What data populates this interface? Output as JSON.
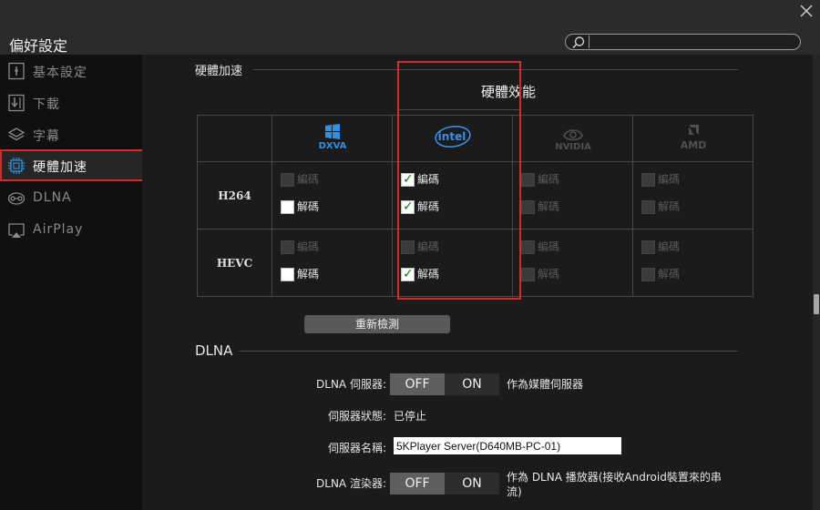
{
  "window": {
    "title": "偏好設定"
  },
  "search": {
    "placeholder": "",
    "value": ""
  },
  "sidebar": {
    "items": [
      {
        "label": "基本設定",
        "icon": "settings-panel-icon",
        "active": false
      },
      {
        "label": "下載",
        "icon": "download-icon",
        "active": false
      },
      {
        "label": "字幕",
        "icon": "layers-icon",
        "active": false
      },
      {
        "label": "硬體加速",
        "icon": "chip-icon",
        "active": true
      },
      {
        "label": "DLNA",
        "icon": "dlna-icon",
        "active": false
      },
      {
        "label": "AirPlay",
        "icon": "airplay-icon",
        "active": false
      }
    ]
  },
  "hardware": {
    "section_title": "硬體加速",
    "performance_label": "硬體效能",
    "columns": [
      {
        "name": "DXVA",
        "logo": "windows-dxva-logo"
      },
      {
        "name": "intel",
        "logo": "intel-logo"
      },
      {
        "name": "NVIDIA",
        "logo": "nvidia-logo"
      },
      {
        "name": "AMD",
        "logo": "amd-logo"
      }
    ],
    "rows": [
      {
        "codec": "H264",
        "cells": [
          {
            "encode": {
              "label": "編碼",
              "checked": false,
              "enabled": false
            },
            "decode": {
              "label": "解碼",
              "checked": false,
              "enabled": true
            }
          },
          {
            "encode": {
              "label": "編碼",
              "checked": true,
              "enabled": true
            },
            "decode": {
              "label": "解碼",
              "checked": true,
              "enabled": true
            }
          },
          {
            "encode": {
              "label": "編碼",
              "checked": false,
              "enabled": false
            },
            "decode": {
              "label": "解碼",
              "checked": false,
              "enabled": false
            }
          },
          {
            "encode": {
              "label": "編碼",
              "checked": false,
              "enabled": false
            },
            "decode": {
              "label": "解碼",
              "checked": false,
              "enabled": false
            }
          }
        ]
      },
      {
        "codec": "HEVC",
        "cells": [
          {
            "encode": {
              "label": "編碼",
              "checked": false,
              "enabled": false
            },
            "decode": {
              "label": "解碼",
              "checked": false,
              "enabled": true
            }
          },
          {
            "encode": {
              "label": "編碼",
              "checked": false,
              "enabled": false
            },
            "decode": {
              "label": "解碼",
              "checked": true,
              "enabled": true
            }
          },
          {
            "encode": {
              "label": "編碼",
              "checked": false,
              "enabled": false
            },
            "decode": {
              "label": "解碼",
              "checked": false,
              "enabled": false
            }
          },
          {
            "encode": {
              "label": "編碼",
              "checked": false,
              "enabled": false
            },
            "decode": {
              "label": "解碼",
              "checked": false,
              "enabled": false
            }
          }
        ]
      }
    ],
    "redetect_label": "重新檢測"
  },
  "dlna": {
    "section_title": "DLNA",
    "server_label": "DLNA 伺服器:",
    "server_off": "OFF",
    "server_on": "ON",
    "server_note": "作為媒體伺服器",
    "status_label": "伺服器狀態:",
    "status_value": "已停止",
    "name_label": "伺服器名稱:",
    "name_value": "5KPlayer Server(D640MB-PC-01)",
    "renderer_label": "DLNA 渲染器:",
    "renderer_off": "OFF",
    "renderer_on": "ON",
    "renderer_note_line1": "作為 DLNA 播放器(接收Android裝置來的串",
    "renderer_note_line2": "流)"
  },
  "colors": {
    "accent_red": "#d42a2a",
    "dxva_blue": "#2f8fe0",
    "intel_blue": "#3a8ee6",
    "check_green": "#1a7a1a"
  }
}
